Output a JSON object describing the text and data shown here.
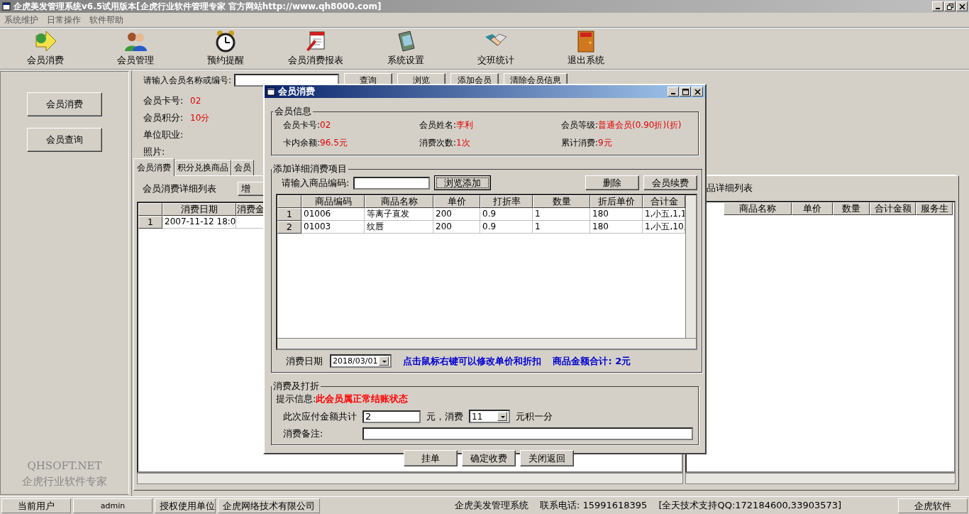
{
  "window": {
    "title": "企虎美发管理系统v6.5试用版本[企虎行业软件管理专家 官方网站http://www.qh8000.com]"
  },
  "menu": [
    "系统维护",
    "日常操作",
    "软件帮助"
  ],
  "toolbar": [
    {
      "label": "会员消费",
      "kind": "arrow"
    },
    {
      "label": "会员管理",
      "kind": "people"
    },
    {
      "label": "预约提醒",
      "kind": "clock"
    },
    {
      "label": "会员消费报表",
      "kind": "notepad"
    },
    {
      "label": "系统设置",
      "kind": "book"
    },
    {
      "label": "交班统计",
      "kind": "handshake"
    },
    {
      "label": "退出系统",
      "kind": "door"
    }
  ],
  "sidebar": {
    "buttons": [
      "会员消费",
      "会员查询"
    ],
    "footer": [
      "QHSOFT.NET",
      "企虎行业软件专家"
    ]
  },
  "search": {
    "label": "请输入会员名称或编号:",
    "buttons": [
      "查询",
      "浏览",
      "添加会员",
      "清除会员信息"
    ]
  },
  "member_info": [
    {
      "label": "会员卡号:",
      "value": "02"
    },
    {
      "label": "会员积分:",
      "value": "10分"
    },
    {
      "label": "单位职业:"
    },
    {
      "label": "照片:"
    }
  ],
  "tabs": [
    {
      "label": "会员消费",
      "selected": true
    },
    {
      "label": "积分兑换商品",
      "selected": false
    },
    {
      "label": "会员",
      "selected": false
    }
  ],
  "consumption_list": {
    "caption": "会员消费详细列表",
    "button": "增",
    "columns": [
      "消费日期",
      "消费金"
    ],
    "rows": [
      {
        "number": "1",
        "cells": [
          "2007-11-12 18:0",
          ""
        ]
      }
    ]
  },
  "product_list": {
    "caption": "品详细列表",
    "columns": [
      "商品名称",
      "单价",
      "数量",
      "合计金额",
      "服务生"
    ]
  },
  "dialog": {
    "title": "会员消费",
    "member_group": {
      "title": "会员信息",
      "fields": [
        {
          "label": "会员卡号:",
          "value": "02"
        },
        {
          "label": "会员姓名:",
          "value": "李利"
        },
        {
          "label": "会员等级:",
          "value": "普通会员(0.90折)(折)"
        },
        {
          "label": "卡内余额:",
          "value": "96.5元"
        },
        {
          "label": "消费次数:",
          "value": "1次"
        },
        {
          "label": "累计消费:",
          "value": "9元"
        }
      ]
    },
    "items_group": {
      "title": "添加详细消费项目",
      "code_label": "请输入商品编码:",
      "buttons": [
        {
          "label": "浏览添加",
          "focused": true
        },
        {
          "label": "删除",
          "focused": false
        },
        {
          "label": "会员续费",
          "focused": false
        }
      ],
      "columns": [
        "商品编码",
        "商品名称",
        "单价",
        "打折率",
        "数量",
        "折后单价",
        "合计金"
      ],
      "rows": [
        {
          "number": "1",
          "cells": [
            "01006",
            "等离子直发",
            "200",
            "0.9",
            "1",
            "180",
            "1,小五,1,1"
          ]
        },
        {
          "number": "2",
          "cells": [
            "01003",
            "纹唇",
            "200",
            "0.9",
            "1",
            "180",
            "1,小五,10,"
          ]
        }
      ],
      "date_label": "消费日期",
      "date": "2018/03/01",
      "hint": "点击鼠标右键可以修改单价和折扣",
      "total": "商品金额合计: 2元"
    },
    "discount_group": {
      "title": "消费及打折",
      "notice_label": "提示信息:",
      "notice": "此会员属正常结账状态",
      "amount_label": "此次应付金额共计",
      "amount": "2",
      "unit_label": "元，消费",
      "points_rate": "11",
      "points_label": "元积一分",
      "remark_label": "消费备注:"
    },
    "buttons": [
      "挂单",
      "确定收费",
      "关闭返回"
    ]
  },
  "status_bar": {
    "left": [
      "当前用户",
      "admin",
      "授权使用单位",
      "企虎网络技术有限公司"
    ],
    "center": [
      "企虎美发管理系统",
      "联系电话: 15991618395",
      "[全天技术支持QQ:172184600,33903573]"
    ],
    "right": "企虎软件"
  }
}
